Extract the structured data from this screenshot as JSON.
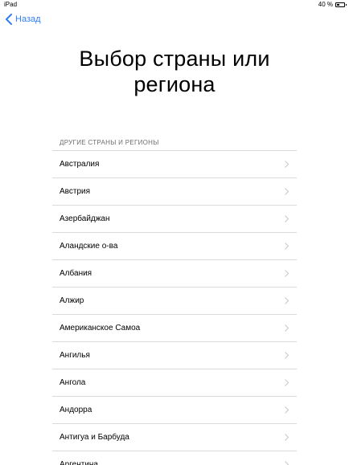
{
  "status_bar": {
    "device": "iPad",
    "battery_text": "40 %",
    "battery_level": 0.4
  },
  "nav": {
    "back_label": "Назад"
  },
  "title": {
    "line1": "Выбор страны или",
    "line2": "региона"
  },
  "section_header": "ДРУГИЕ СТРАНЫ И РЕГИОНЫ",
  "countries": [
    "Австралия",
    "Австрия",
    "Азербайджан",
    "Аландские о-ва",
    "Албания",
    "Алжир",
    "Американское Самоа",
    "Ангилья",
    "Ангола",
    "Андорра",
    "Антигуа и Барбуда",
    "Аргентина"
  ],
  "colors": {
    "accent": "#2f7ef6",
    "separator": "#d9d9de",
    "chevron": "#c7c7cc",
    "section_header": "#6d6d72"
  }
}
